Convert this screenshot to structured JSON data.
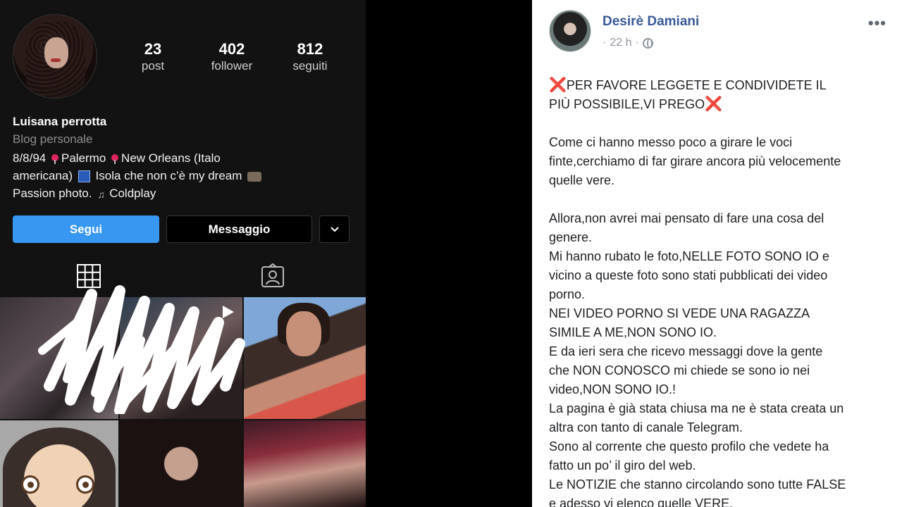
{
  "instagram": {
    "stats": [
      {
        "value": "23",
        "label": "post"
      },
      {
        "value": "402",
        "label": "follower"
      },
      {
        "value": "812",
        "label": "seguiti"
      }
    ],
    "name": "Luisana perrotta",
    "category": "Blog personale",
    "bio": {
      "l1a": "8/8/94",
      "l1b": "Palermo",
      "l1c": "New Orleans (Italo",
      "l2a": "americana)",
      "l2b": "Isola che non c’è my dream",
      "l3a": "Passion photo.",
      "l3b": "Coldplay"
    },
    "buttons": {
      "follow": "Segui",
      "message": "Messaggio"
    },
    "icons": [
      "grid-icon",
      "tagged-icon",
      "chevron-down-icon",
      "pin-icon"
    ],
    "colors": {
      "follow": "#3897f0",
      "background": "#121212"
    }
  },
  "facebook": {
    "author": "Desirè Damiani",
    "time": "22 h",
    "more": "•••",
    "post": {
      "heading1": "PER FAVORE LEGGETE E CONDIVIDETE IL",
      "heading2": "PIÙ POSSIBILE,VI PREGO",
      "cross": "❌",
      "lines": [
        "Come ci hanno messo poco a girare le voci",
        "finte,cerchiamo di far girare ancora più velocemente",
        "quelle vere.",
        "",
        "Allora,non avrei mai pensato di fare una cosa del",
        "genere.",
        "Mi hanno rubato le foto,NELLE FOTO SONO IO e",
        "vicino a queste foto sono stati pubblicati dei video",
        "porno.",
        "NEI VIDEO PORNO SI VEDE UNA RAGAZZA",
        "SIMILE A ME,NON SONO IO.",
        "E da ieri sera che ricevo messaggi dove la gente",
        "che NON CONOSCO mi chiede se sono io nei",
        "video,NON SONO IO.!",
        "La pagina è già stata chiusa ma ne è stata creata un",
        "altra con tanto di canale Telegram.",
        "Sono al corrente che questo profilo che vedete ha",
        "fatto un po’ il giro del web.",
        "Le NOTIZIE che stanno circolando sono tutte FALSE",
        "e adesso vi elenco quelle VERE."
      ]
    },
    "colors": {
      "name": "#385898",
      "accent": "#e0242e"
    }
  }
}
